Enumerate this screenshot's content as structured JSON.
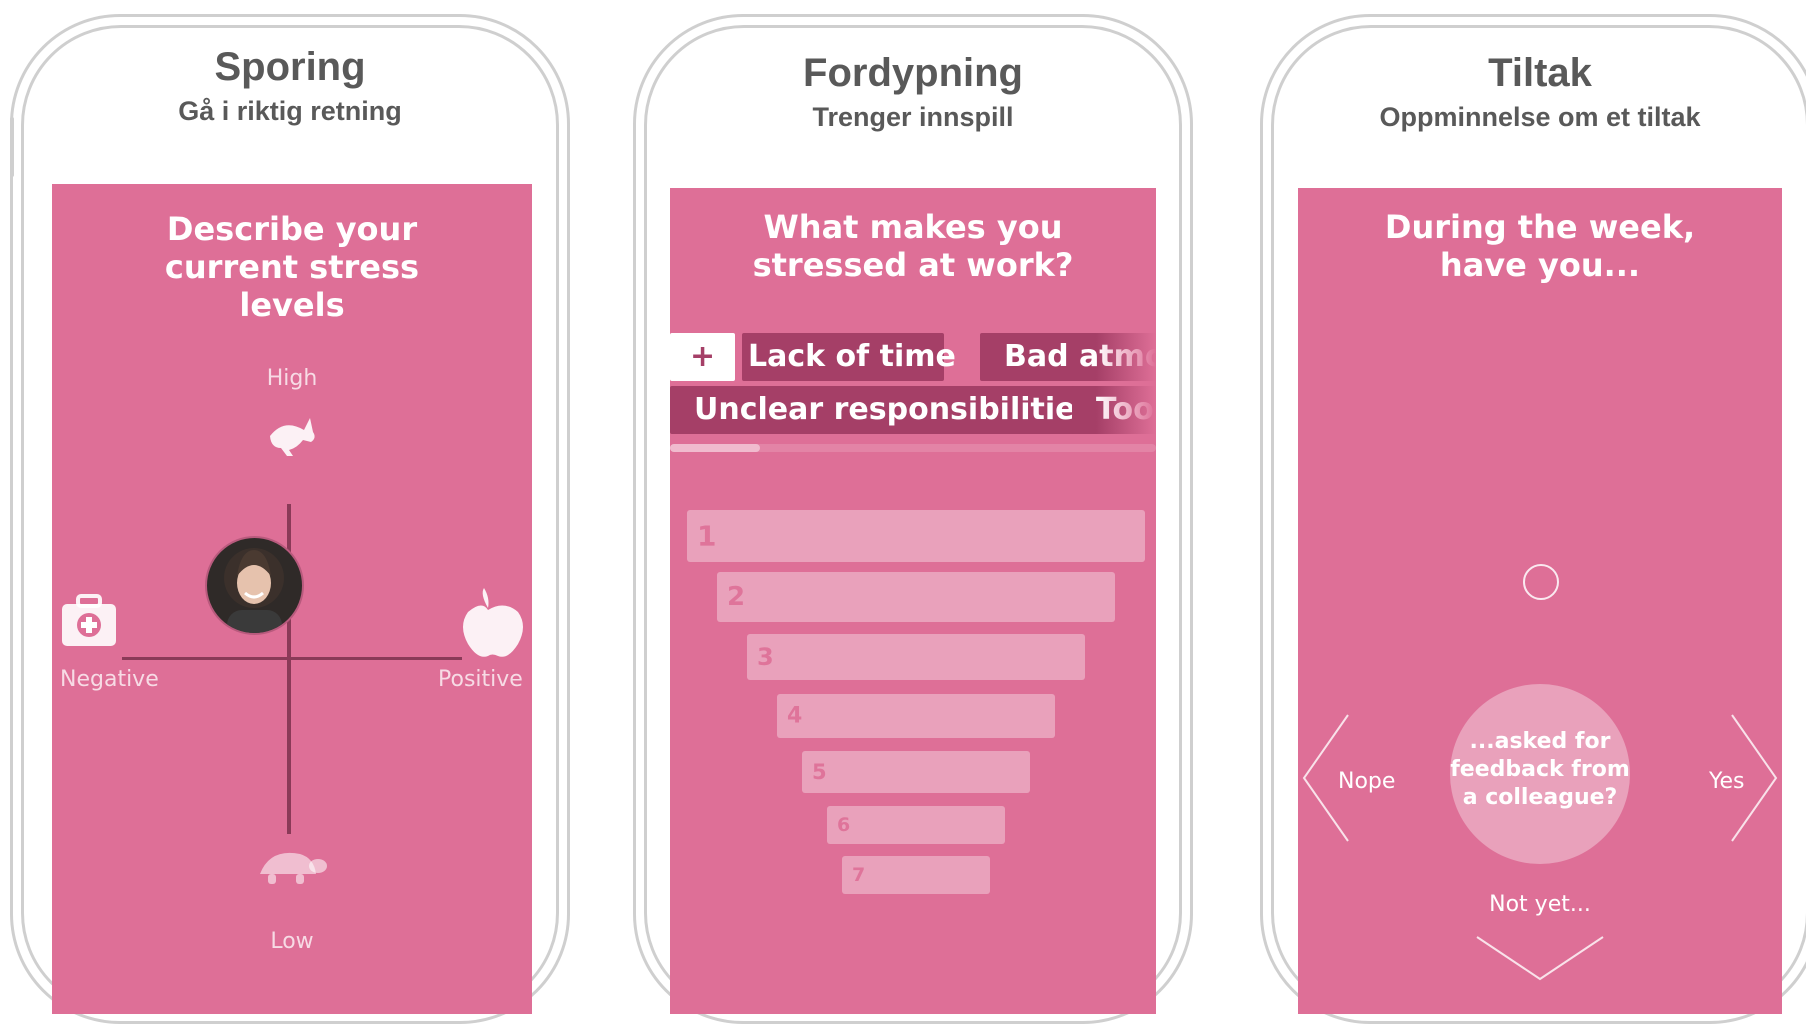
{
  "phones": [
    {
      "title": "Sporing",
      "subtitle": "Gå i riktig retning",
      "question": "Describe your current stress levels",
      "labels": {
        "high": "High",
        "low": "Low",
        "negative": "Negative",
        "positive": "Positive"
      }
    },
    {
      "title": "Fordypning",
      "subtitle": "Trenger innspill",
      "question": "What makes you stressed at work?",
      "chips_row1": [
        "+",
        "Lack of time",
        "Bad atmo"
      ],
      "chips_row2": [
        "Unclear responsibilities",
        "Too"
      ],
      "ranks": [
        "1",
        "2",
        "3",
        "4",
        "5",
        "6",
        "7"
      ]
    },
    {
      "title": "Tiltak",
      "subtitle": "Oppminnelse om et tiltak",
      "question": "During the week, have you...",
      "card_text": "...asked for feedback from a colleague?",
      "nope": "Nope",
      "yes": "Yes",
      "not_yet": "Not yet..."
    }
  ],
  "colors": {
    "screen": "#de6f97",
    "chip": "#a53f67",
    "axis": "#8a3a58",
    "frame": "#cfcfcf",
    "header_text": "#595959"
  }
}
